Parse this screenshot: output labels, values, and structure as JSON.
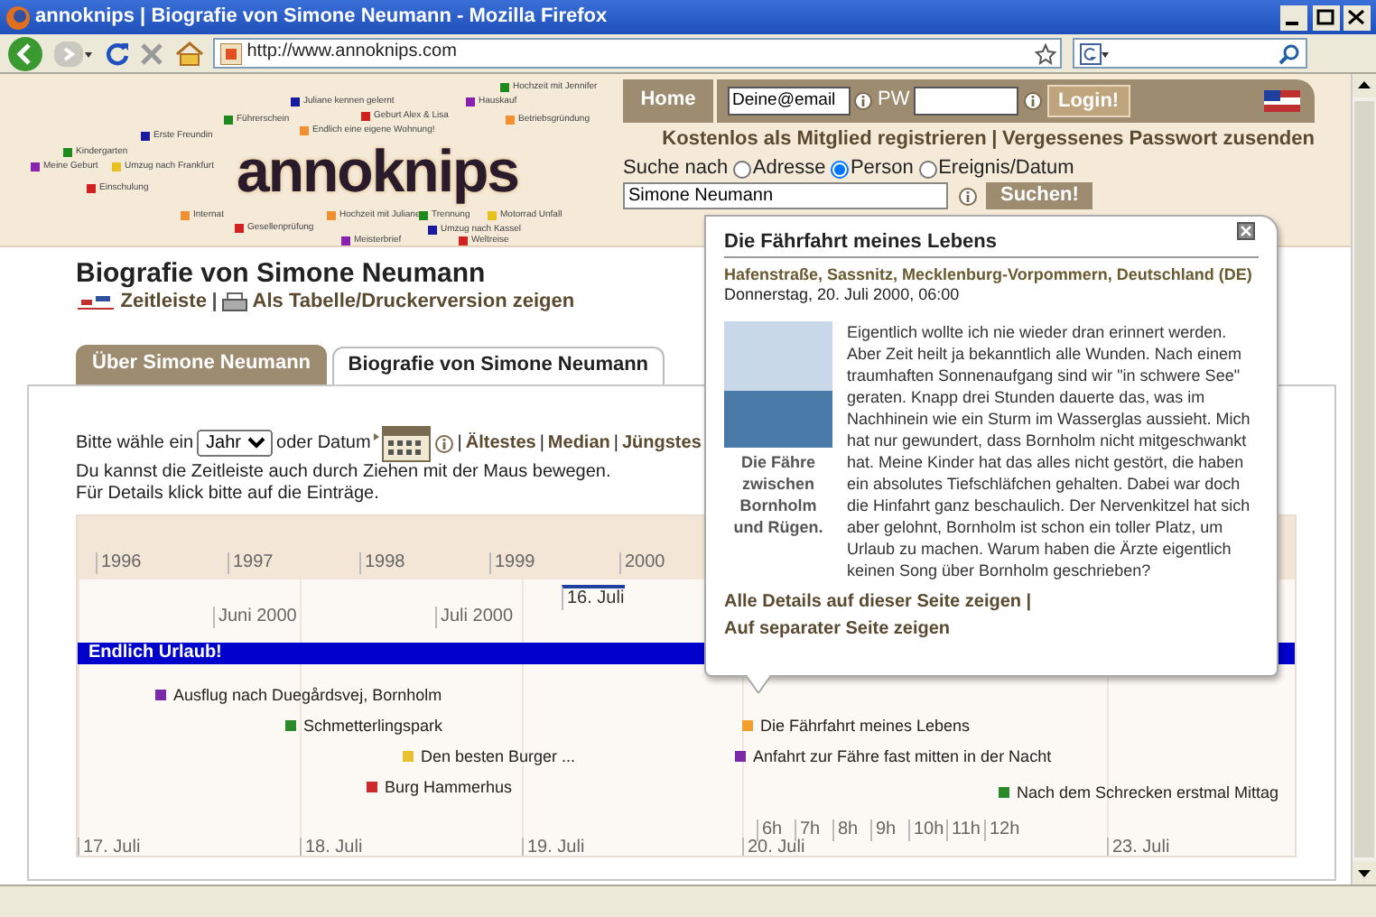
{
  "window": {
    "title": "annoknips | Biografie von Simone Neumann - Mozilla Firefox"
  },
  "browser": {
    "url": "http://www.annoknips.com"
  },
  "header": {
    "logo": "annoknips",
    "logo_labels": [
      {
        "text": "Hochzeit mit Jennifer",
        "color": "#1e8a1e"
      },
      {
        "text": "Juliane kennen gelernt",
        "color": "#1a1aa0"
      },
      {
        "text": "Hauskauf",
        "color": "#8a22b0"
      },
      {
        "text": "Führerschein",
        "color": "#1e8a1e"
      },
      {
        "text": "Geburt Alex & Lisa",
        "color": "#d02020"
      },
      {
        "text": "Betriebsgründung",
        "color": "#f09030"
      },
      {
        "text": "Erste Freundin",
        "color": "#1a1aa0"
      },
      {
        "text": "Endlich eine eigene Wohnung!",
        "color": "#f09030"
      },
      {
        "text": "Kindergarten",
        "color": "#1e8a1e"
      },
      {
        "text": "Meine Geburt",
        "color": "#8a22b0"
      },
      {
        "text": "Umzug nach Frankfurt",
        "color": "#e8c020"
      },
      {
        "text": "Einschulung",
        "color": "#d02020"
      },
      {
        "text": "Internat",
        "color": "#f09030"
      },
      {
        "text": "Hochzeit mit Juliane",
        "color": "#f09030"
      },
      {
        "text": "Trennung",
        "color": "#1e8a1e"
      },
      {
        "text": "Motorrad Unfall",
        "color": "#e8c020"
      },
      {
        "text": "Gesellenprüfung",
        "color": "#d02020"
      },
      {
        "text": "Umzug nach Kassel",
        "color": "#1a1aa0"
      },
      {
        "text": "Meisterbrief",
        "color": "#8a22b0"
      },
      {
        "text": "Weltreise",
        "color": "#d02020"
      }
    ],
    "nav": {
      "home": "Home",
      "email_value": "Deine@email",
      "pw_label": "PW",
      "login": "Login!"
    },
    "account_links": [
      "Kostenlos als Mitglied registrieren",
      "Vergessenes Passwort zusenden"
    ],
    "separator": "|",
    "search": {
      "label": "Suche nach",
      "options": [
        {
          "label": "Adresse",
          "selected": false
        },
        {
          "label": "Person",
          "selected": true
        },
        {
          "label": "Ereignis/Datum",
          "selected": false
        }
      ],
      "value": "Simone Neumann",
      "button": "Suchen!"
    }
  },
  "page": {
    "title": "Biografie von Simone Neumann",
    "views": [
      "Zeitleiste",
      "Als Tabelle/Druckerversion zeigen"
    ],
    "separator": "|"
  },
  "tabs": [
    {
      "label": "Über Simone Neumann",
      "selected": false
    },
    {
      "label": "Biografie von Simone Neumann",
      "selected": true
    }
  ],
  "controls": {
    "prefix": "Bitte wähle ein",
    "select_value": "Jahr",
    "middle": "oder Datum",
    "jumps": [
      "Ältestes",
      "Median",
      "Jüngstes"
    ],
    "separator": "|",
    "hints": [
      "Du kannst die Zeitleiste auch durch Ziehen mit der Maus bewegen.",
      "Für Details klick bitte auf die Einträge."
    ]
  },
  "timeline": {
    "years": [
      "1996",
      "1997",
      "1998",
      "1999",
      "2000"
    ],
    "months": [
      "Juni 2000",
      "Juli 2000"
    ],
    "marker": "16. Juli",
    "banner": "Endlich Urlaub!",
    "events": [
      {
        "label": "Ausflug nach Duegårdsvej, Bornholm",
        "color": "#7a2aa8"
      },
      {
        "label": "Schmetterlingspark",
        "color": "#2a8a2a"
      },
      {
        "label": "Den besten Burger ...",
        "color": "#e8c030"
      },
      {
        "label": "Burg Hammerhus",
        "color": "#cc2a2a"
      },
      {
        "label": "Die Fährfahrt meines Lebens",
        "color": "#f0a030"
      },
      {
        "label": "Anfahrt zur Fähre fast mitten in der Nacht",
        "color": "#7a2aa8"
      },
      {
        "label": "Nach dem Schrecken erstmal Mittag",
        "color": "#2a8a2a"
      }
    ],
    "hours": [
      "6h",
      "7h",
      "8h",
      "9h",
      "10h",
      "11h",
      "12h"
    ],
    "days": [
      "17. Juli",
      "18. Juli",
      "19. Juli",
      "20. Juli",
      "23. Juli"
    ]
  },
  "popup": {
    "title": "Die Fährfahrt meines Lebens",
    "address": "Hafenstraße, Sassnitz, Mecklenburg-Vorpommern, Deutschland (DE)",
    "date": "Donnerstag, 20. Juli 2000, 06:00",
    "caption": "Die Fähre zwischen Bornholm und Rügen.",
    "text": "Eigentlich wollte ich nie wieder dran erinnert werden. Aber Zeit heilt ja bekanntlich alle Wunden. Nach einem traumhaften Sonnenaufgang sind wir \"in schwere See\" geraten. Knapp drei Stunden dauerte das, was im Nachhinein wie ein Sturm im Wasserglas aussieht. Mich hat nur gewundert, dass Bornholm nicht mitgeschwankt hat. Meine Kinder hat das alles nicht gestört, die haben ein absolutes Tiefschläfchen gehalten. Dabei war doch die Hinfahrt ganz beschaulich. Der Nervenkitzel hat sich aber gelohnt, Bornholm ist schon ein toller Platz, um Urlaub zu machen. Warum haben die Ärzte eigentlich keinen Song über Bornholm geschrieben?",
    "links": [
      "Alle Details auf dieser Seite zeigen",
      "Auf separater Seite zeigen"
    ],
    "separator": "|"
  }
}
